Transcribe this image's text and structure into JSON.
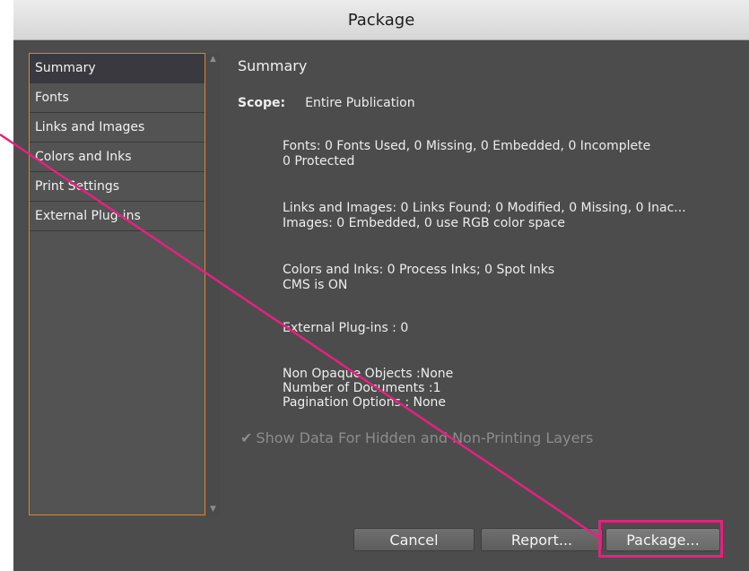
{
  "window": {
    "title": "Package"
  },
  "sidebar": {
    "items": [
      {
        "label": "Summary",
        "selected": true
      },
      {
        "label": "Fonts"
      },
      {
        "label": "Links and Images"
      },
      {
        "label": "Colors and Inks"
      },
      {
        "label": "Print Settings"
      },
      {
        "label": "External Plug-ins"
      }
    ]
  },
  "summary": {
    "heading": "Summary",
    "scope_label": "Scope:",
    "scope_value": "Entire Publication",
    "fonts_line1": "Fonts: 0 Fonts Used, 0 Missing, 0 Embedded, 0 Incomplete",
    "fonts_line2": "0 Protected",
    "links_line1": "Links and Images: 0 Links Found; 0 Modified, 0 Missing, 0 Inac...",
    "links_line2": "Images: 0 Embedded, 0 use RGB color space",
    "colors_line1": "Colors and Inks: 0 Process Inks; 0 Spot Inks",
    "colors_line2": "CMS is ON",
    "plugins_line": "External Plug-ins : 0",
    "misc_line1": "Non Opaque Objects :None",
    "misc_line2": "Number of Documents :1",
    "misc_line3": "Pagination Options : None"
  },
  "options": {
    "show_hidden_label": "Show Data For Hidden and Non-Printing Layers",
    "show_hidden_checked": true
  },
  "buttons": {
    "cancel": "Cancel",
    "report": "Report...",
    "package": "Package..."
  },
  "colors": {
    "annotation": "#e4227e",
    "focus_border": "#d9882f"
  }
}
